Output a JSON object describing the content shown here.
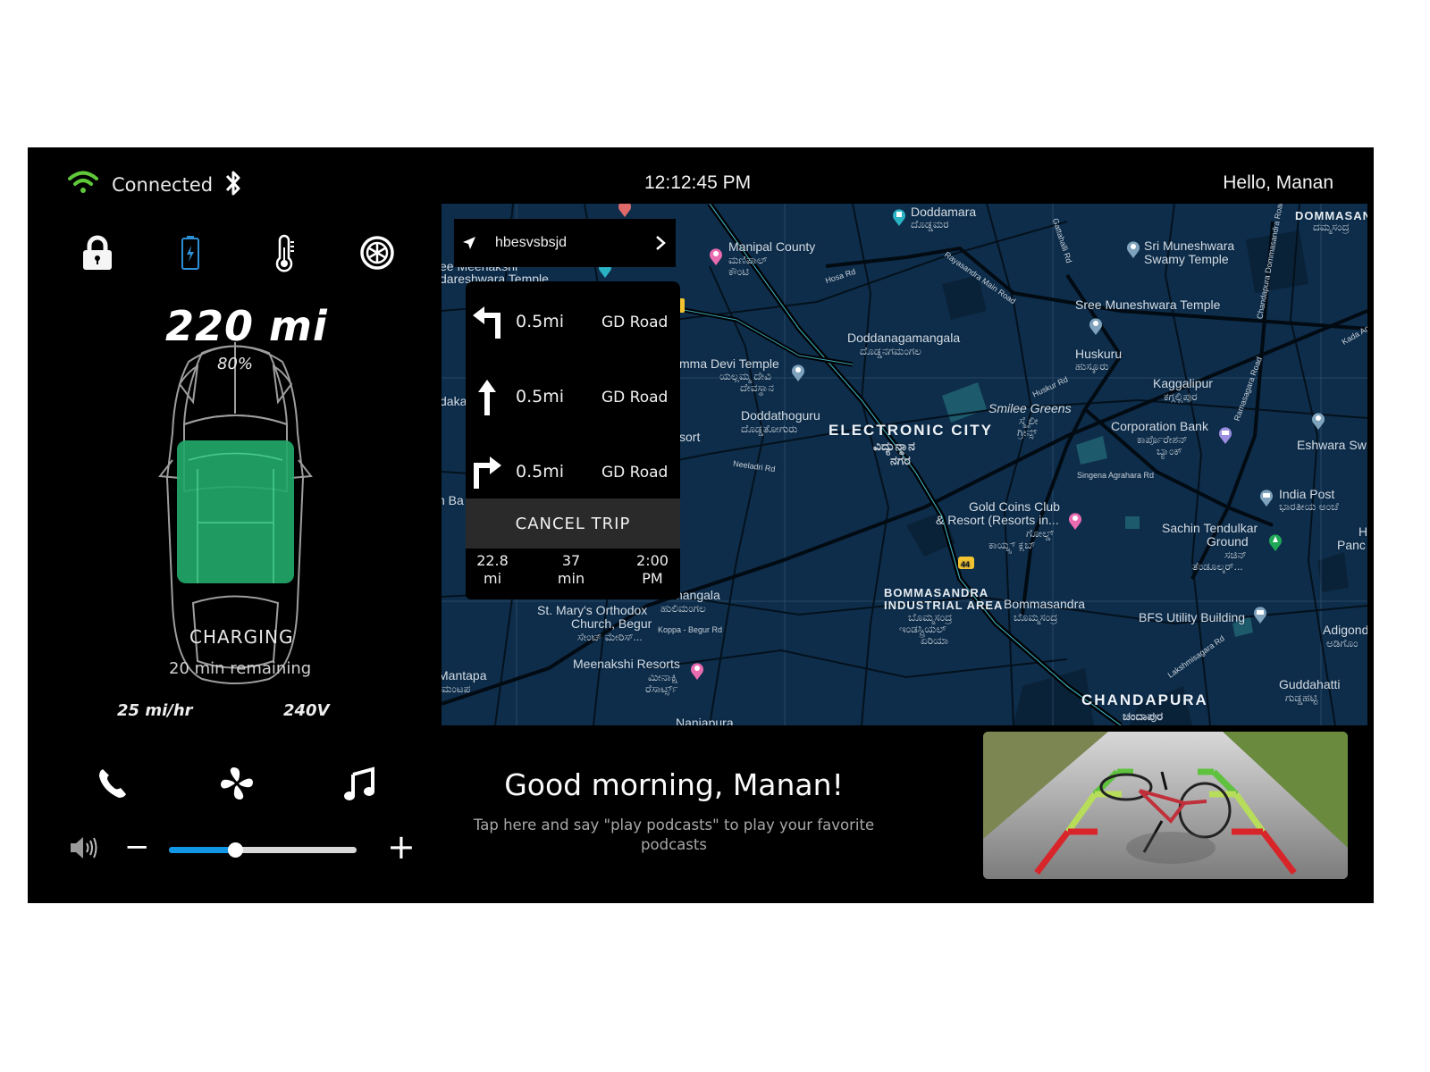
{
  "status": {
    "connection_label": "Connected",
    "wifi_icon": "wifi-icon",
    "bluetooth_icon": "bluetooth-icon",
    "clock": "12:12:45 PM",
    "greeting": "Hello, Manan"
  },
  "quick_controls": [
    {
      "name": "lock",
      "icon": "lock-icon"
    },
    {
      "name": "battery",
      "icon": "battery-charging-icon",
      "color": "#2d8fd6"
    },
    {
      "name": "temperature",
      "icon": "thermometer-icon"
    },
    {
      "name": "tires",
      "icon": "wheel-icon"
    }
  ],
  "vehicle": {
    "range": "220 mi",
    "battery_percent": "80%",
    "battery_level": 0.8,
    "charge_color": "#22a86a",
    "charging_label": "CHARGING",
    "time_remaining": "20 min remaining",
    "charge_rate": "25 mi/hr",
    "voltage": "240V"
  },
  "bottom_controls": [
    {
      "name": "phone",
      "icon": "phone-icon"
    },
    {
      "name": "climate",
      "icon": "fan-icon"
    },
    {
      "name": "music",
      "icon": "music-note-icon"
    }
  ],
  "volume": {
    "icon": "speaker-icon",
    "minus_label": "−",
    "plus_label": "+",
    "level": 0.35,
    "accent": "#1296e6"
  },
  "navigation": {
    "destination": "hbesvsbsjd",
    "steps": [
      {
        "turn": "turn-left",
        "distance": "0.5mi",
        "road": "GD Road"
      },
      {
        "turn": "straight",
        "distance": "0.5mi",
        "road": "GD Road"
      },
      {
        "turn": "turn-right",
        "distance": "0.5mi",
        "road": "GD Road"
      }
    ],
    "cancel_label": "CANCEL TRIP",
    "trip_stats": [
      {
        "value": "22.8",
        "unit": "mi"
      },
      {
        "value": "37",
        "unit": "min"
      },
      {
        "value": "2:00",
        "unit": "PM"
      }
    ]
  },
  "map": {
    "labels": {
      "doddamara": "Doddamara",
      "doddamara_kn": "ದೊಡ್ಡಮರ",
      "manipal": "Manipal County",
      "manipal_kn": "ಮಣಿಪಾಲ್",
      "manipal_kn2": "ಕೌಂಟಿ",
      "sri_muneshwara": "Sri Muneshwara",
      "sri_muneshwara2": "Swamy Temple",
      "dommasandra": "DOMMASANDRA",
      "dommasandra_kn": "ದಮ್ಮಸಂದ್ರ",
      "sree_muneshwara": "Sree Muneshwara Temple",
      "huskuru": "Huskuru",
      "huskuru_kn": "ಹುಸ್ಕೂರು",
      "doddanagamangala": "Doddanagamangala",
      "doddanagamangala_kn": "ದೊಡ್ಡನಗಮಂಗಲ",
      "yellamma": "mma Devi Temple",
      "yellamma_kn": "ಯಲ್ಲಮ್ಮ ದೇವಿ",
      "yellamma_kn2": "ದೇವಸ್ಥಾನ",
      "kaggalipur": "Kaggalipur",
      "kaggalipur_kn": "ಕಗ್ಗಲ್ಲಿಪುರ",
      "smilee": "Smilee Greens",
      "smilee_kn": "ಸ್ಮೈಲೀ",
      "smilee_kn2": "ಗ್ರೀನ್ಸ್",
      "doddathoguru": "Doddathoguru",
      "doddathoguru_kn": "ದೊಡ್ಡತೋಗುರು",
      "electronic_city": "ELECTRONIC CITY",
      "electronic_city_kn": "ವಿದ್ಯುನ್ಮಾನ",
      "electronic_city_kn2": "ನಗರ",
      "corporation_bank": "Corporation Bank",
      "corporation_bank_kn": "ಕಾರ್ಪೊರೇಶನ್",
      "corporation_bank_kn2": "ಬ್ಯಾಂಕ್",
      "eshwara": "Eshwara Sw",
      "resort": "sort",
      "india_post": "India Post",
      "india_post_kn": "ಭಾರತೀಯ ಅಂಚೆ",
      "gold_coins": "Gold Coins Club",
      "gold_coins2": "& Resort (Resorts in...",
      "gold_coins_kn": "ಗೋಲ್ಡ್",
      "gold_coins_kn2": "ಕಾಯ್ನ್ಸ್ ಕ್ಲಬ್",
      "sachin": "Sachin Tendulkar",
      "sachin2": "Ground",
      "sachin_kn": "ಸಚಿನ್",
      "sachin_kn2": "ತೆಂಡೂಲ್ಕರ್...",
      "panc": "Panc",
      "h": "H",
      "st_marys": "St. Mary's Orthodox",
      "st_marys2": "Church, Begur",
      "st_marys_kn": "ಸೇಂಟ್ ಮೇರಿಸ್...",
      "hulimangala": "imangala",
      "hulimangala_kn": "ಹುಲಿಮಂಗಲ",
      "bommasandra_ia": "BOMMASANDRA",
      "bommasandra_ia2": "INDUSTRIAL AREA",
      "bommasandra_ia_kn": "ಬೊಮ್ಮಸಂದ್ರ",
      "bommasandra_ia_kn2": "ಇಂಡಸ್ಟ್ರಿಯಲ್",
      "bommasandra_ia_kn3": "ಏರಿಯಾ",
      "bommasandra": "Bommasandra",
      "bommasandra_kn": "ಬೊಮ್ಮಸಂದ್ರ",
      "bfs": "BFS Utility Building",
      "adigondana": "Adigond",
      "adigondana_kn": "ಅಡಿಗೊಂ",
      "meenakshi": "Meenakshi Resorts",
      "meenakshi_kn": "ಮೀನಾಕ್ಷಿ",
      "meenakshi_kn2": "ರೆಸಾರ್ಟ್ಸ್",
      "mantapa": "Mantapa",
      "mantapa_kn": "ಮಂಟಪ",
      "chandapura": "CHANDAPURA",
      "chandapura_kn": "ಚಂದಾಪುರ",
      "guddahatti": "Guddahatti",
      "guddahatti_kn": "ಗುಡ್ಡಹಟ್ಟಿ",
      "nanjapura": "Nanjapura",
      "dakal": "dakal",
      "n_ba": "n Ba",
      "meenakshi_temple": "ee Meenakshi",
      "sundareshwara": "dareshwara Temple",
      "hosa_rd": "Hosa Rd",
      "rayasandra": "Rayasandra Main Road",
      "gattahalli": "Gattahalli Rd",
      "chandapura_dommasandra": "Chandapura Dommasandra Road",
      "ramasagara": "Ramasagara Road",
      "huskur_rd": "Huskur Rd",
      "neeladri": "Neeladri Rd",
      "singena": "Singena Agrahara Rd",
      "lakshmisagara": "Lakshmisagara Rd",
      "koppa_begur": "Koppa - Begur Rd",
      "kada": "Kada Ag",
      "nh44": "44"
    }
  },
  "assistant": {
    "greeting": "Good morning, Manan!",
    "hint": "Tap here and say \"play podcasts\" to play your favorite podcasts"
  },
  "camera": {
    "label": "rear-camera-view"
  }
}
